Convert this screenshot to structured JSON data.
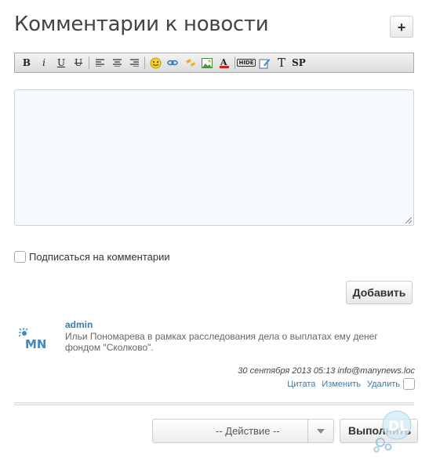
{
  "page_title": "Комментарии к новости",
  "plus_label": "+",
  "toolbar": {
    "bold": "B",
    "italic": "i",
    "underline": "U",
    "strike": "U",
    "hide": "HIDE",
    "text": "T",
    "sp": "SP"
  },
  "subscribe_label": "Подписаться на комментарии",
  "add_button": "Добавить",
  "comment": {
    "author": "admin",
    "text": "Ильи Пономарева в рамках расследования дела о выплатах ему денег фондом \"Сколково\".",
    "meta": "30 сентября 2013 05:13 info@manynews.loc",
    "quote": "Цитата",
    "edit": "Изменить",
    "delete": "Удалить"
  },
  "action_select": "-- Действие --",
  "execute_button": "Выполнить",
  "colors": {
    "link": "#3a79a8",
    "editor_bg": "#f5fafd"
  }
}
